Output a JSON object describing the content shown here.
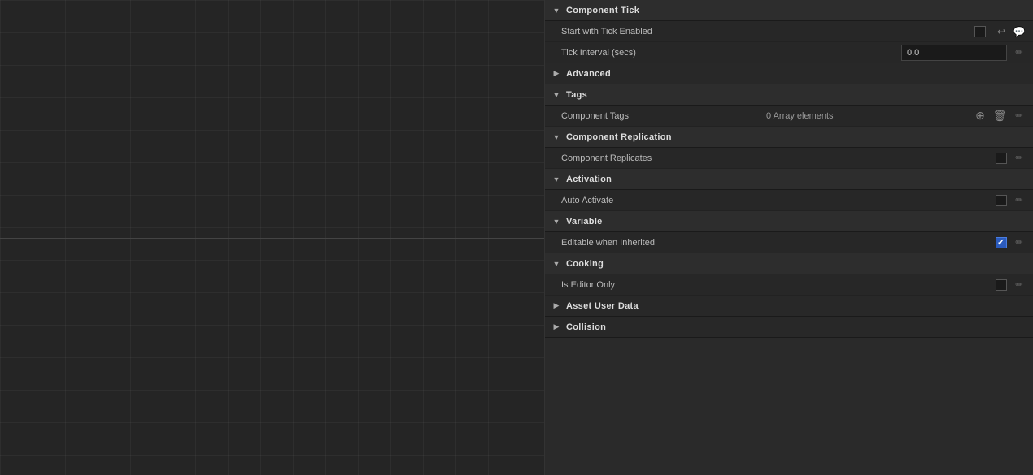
{
  "canvas": {
    "label": "canvas-area"
  },
  "sections": [
    {
      "id": "component-tick",
      "label": "Component Tick",
      "expanded": true,
      "properties": [
        {
          "id": "start-tick-enabled",
          "name": "Start with Tick Enabled",
          "type": "checkbox",
          "checked": false,
          "showResetComment": true
        },
        {
          "id": "tick-interval",
          "name": "Tick Interval (secs)",
          "type": "input",
          "value": "0.0",
          "showEdit": true
        }
      ]
    },
    {
      "id": "advanced",
      "label": "Advanced",
      "expanded": false,
      "properties": []
    },
    {
      "id": "tags",
      "label": "Tags",
      "expanded": true,
      "properties": [
        {
          "id": "component-tags",
          "name": "Component Tags",
          "type": "array",
          "arrayText": "0 Array elements",
          "showAddDelete": true,
          "showEdit": true
        }
      ]
    },
    {
      "id": "component-replication",
      "label": "Component Replication",
      "expanded": true,
      "properties": [
        {
          "id": "component-replicates",
          "name": "Component Replicates",
          "type": "checkbox",
          "checked": false,
          "showEdit": true
        }
      ]
    },
    {
      "id": "activation",
      "label": "Activation",
      "expanded": true,
      "properties": [
        {
          "id": "auto-activate",
          "name": "Auto Activate",
          "type": "checkbox",
          "checked": false,
          "showEdit": true
        }
      ]
    },
    {
      "id": "variable",
      "label": "Variable",
      "expanded": true,
      "properties": [
        {
          "id": "editable-when-inherited",
          "name": "Editable when Inherited",
          "type": "checkbox",
          "checked": true,
          "showEdit": true
        }
      ]
    },
    {
      "id": "cooking",
      "label": "Cooking",
      "expanded": true,
      "properties": [
        {
          "id": "is-editor-only",
          "name": "Is Editor Only",
          "type": "checkbox",
          "checked": false,
          "showEdit": true
        }
      ]
    },
    {
      "id": "asset-user-data",
      "label": "Asset User Data",
      "expanded": false,
      "properties": []
    },
    {
      "id": "collision",
      "label": "Collision",
      "expanded": false,
      "properties": []
    }
  ],
  "icons": {
    "chevron_down": "▼",
    "chevron_right": "▶",
    "reset": "↩",
    "comment": "💬",
    "add": "⊕",
    "delete": "🗑",
    "edit": "✏"
  }
}
